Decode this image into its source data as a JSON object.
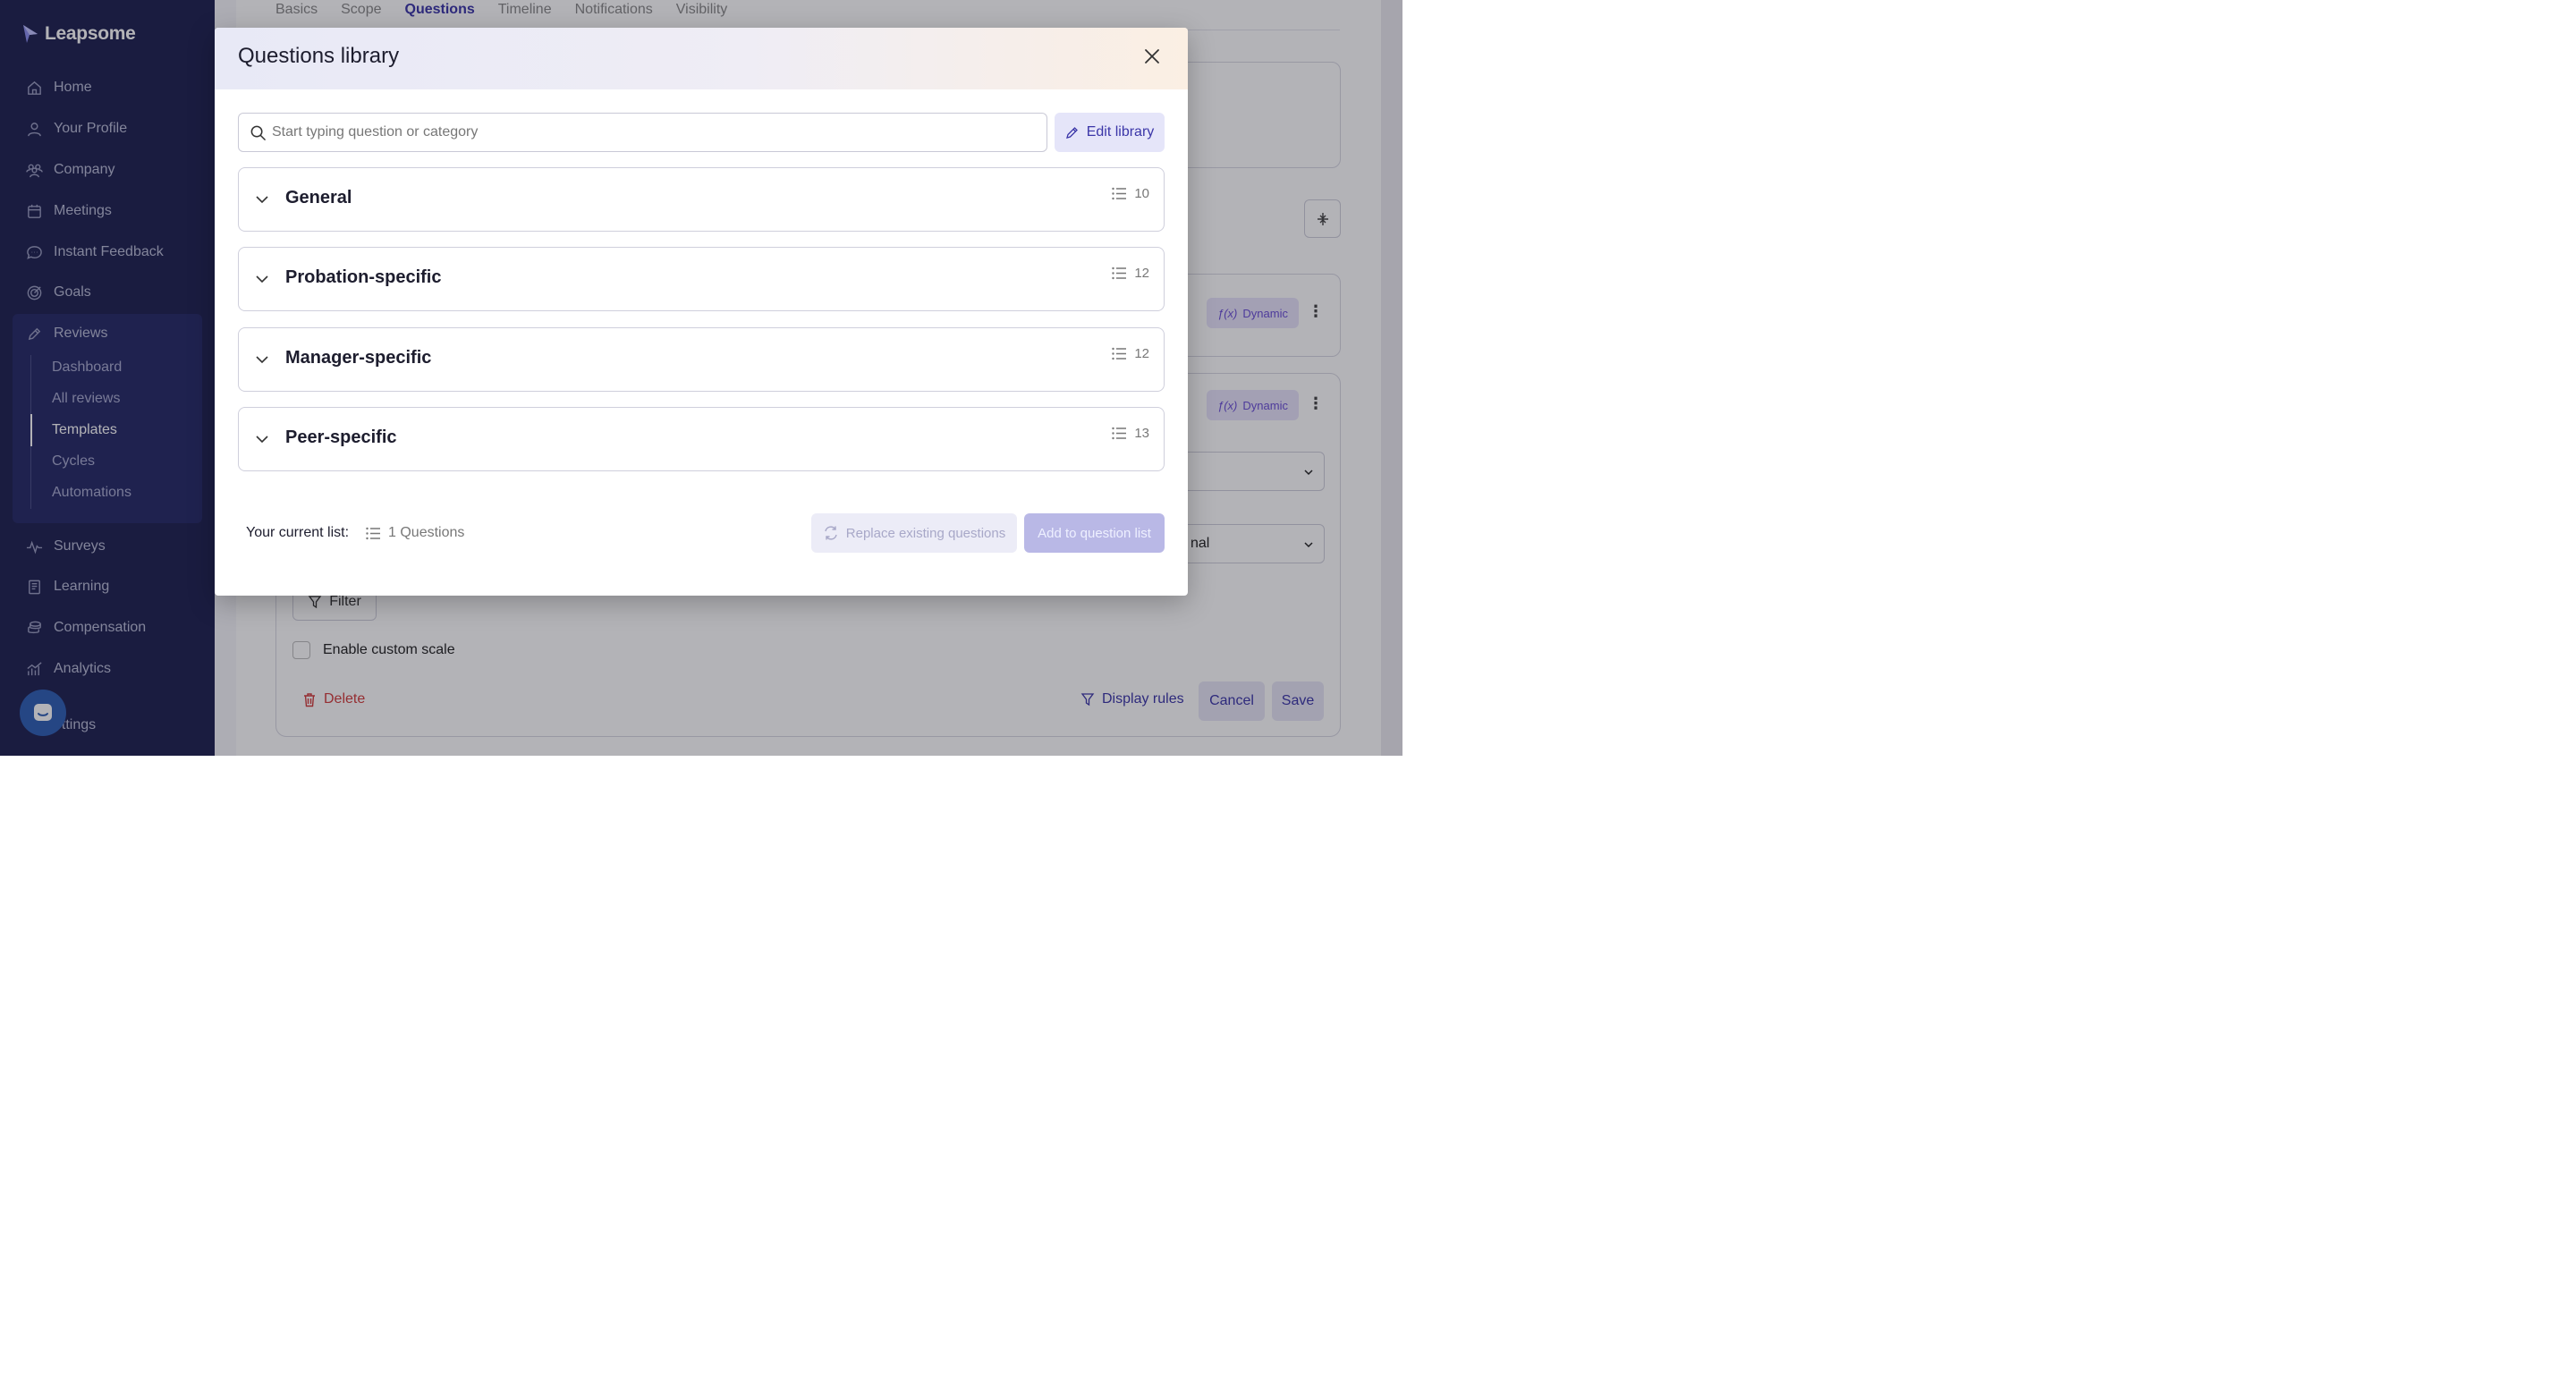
{
  "sidebar": {
    "logo": "Leapsome",
    "items": [
      {
        "label": "Home",
        "icon": "home-icon"
      },
      {
        "label": "Your Profile",
        "icon": "user-icon"
      },
      {
        "label": "Company",
        "icon": "people-icon"
      },
      {
        "label": "Meetings",
        "icon": "calendar-icon"
      },
      {
        "label": "Instant Feedback",
        "icon": "chat-icon"
      },
      {
        "label": "Goals",
        "icon": "target-icon"
      },
      {
        "label": "Reviews",
        "icon": "pencil-icon"
      },
      {
        "label": "Surveys",
        "icon": "pulse-icon"
      },
      {
        "label": "Learning",
        "icon": "book-icon"
      },
      {
        "label": "Compensation",
        "icon": "coins-icon"
      },
      {
        "label": "Analytics",
        "icon": "chart-icon"
      },
      {
        "label": "ettings",
        "icon": "settings-icon"
      }
    ],
    "review_sub": [
      "Dashboard",
      "All reviews",
      "Templates",
      "Cycles",
      "Automations"
    ],
    "active_sub": "Templates"
  },
  "background": {
    "tabs": [
      "Basics",
      "Scope",
      "Questions",
      "Timeline",
      "Notifications",
      "Visibility"
    ],
    "active_tab": "Questions",
    "dynamic_label": "Dynamic",
    "select_partial": "nal",
    "filter_label": "Filter",
    "custom_scale_label": "Enable custom scale",
    "delete_label": "Delete",
    "display_rules_label": "Display rules",
    "cancel_label": "Cancel",
    "save_label": "Save"
  },
  "modal": {
    "title": "Questions library",
    "search_placeholder": "Start typing question or category",
    "edit_library_label": "Edit library",
    "categories": [
      {
        "name": "General",
        "count": "10"
      },
      {
        "name": "Probation-specific",
        "count": "12"
      },
      {
        "name": "Manager-specific",
        "count": "12"
      },
      {
        "name": "Peer-specific",
        "count": "13"
      }
    ],
    "current_list_label": "Your current list:",
    "current_list_count": "1 Questions",
    "replace_label": "Replace existing questions",
    "add_label": "Add to question list"
  },
  "colors": {
    "sidebar_bg": "#1e2150",
    "accent": "#3b36a8",
    "danger": "#d33b3b",
    "dynamic_badge": "#6b4fd6"
  }
}
